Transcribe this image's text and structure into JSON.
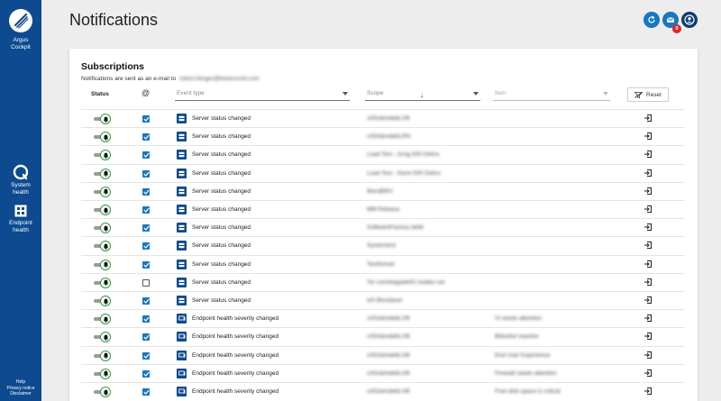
{
  "sidebar": {
    "brand": [
      "Argus",
      "Cockpit"
    ],
    "items": [
      {
        "label": [
          "System",
          "health"
        ],
        "icon": "system-health-icon"
      },
      {
        "label": [
          "Endpoint",
          "health"
        ],
        "icon": "endpoint-health-icon"
      }
    ],
    "footer": [
      "Help",
      "Privacy notice",
      "Disclaimer"
    ]
  },
  "header": {
    "title": "Notifications",
    "badge_count": "0"
  },
  "subscriptions": {
    "title": "Subscriptions",
    "subtitle": "Notifications are sent as an e-mail to",
    "email": "robert.klinger@betamundi.com",
    "col_status": "Status",
    "col_email": "@",
    "filter_event_type": "Event type",
    "filter_scope": "Scope",
    "filter_item": "Item",
    "reset_label": "Reset",
    "rows": [
      {
        "enabled": true,
        "email": true,
        "type": "server",
        "event": "Server status changed",
        "scope": "sXDsbmdebLXB",
        "item": ""
      },
      {
        "enabled": true,
        "email": true,
        "type": "server",
        "event": "Server status changed",
        "scope": "sXDsbmdebLRN",
        "item": ""
      },
      {
        "enabled": true,
        "email": true,
        "type": "server",
        "event": "Server status changed",
        "scope": "Load Test - Grog 500 Delivs",
        "item": ""
      },
      {
        "enabled": true,
        "email": true,
        "type": "server",
        "event": "Server status changed",
        "scope": "Load Test - Dorm 500 Delivs",
        "item": ""
      },
      {
        "enabled": true,
        "email": true,
        "type": "server",
        "event": "Server status changed",
        "scope": "MoroBRH",
        "item": ""
      },
      {
        "enabled": true,
        "email": true,
        "type": "server",
        "event": "Server status changed",
        "scope": "MM Release",
        "item": ""
      },
      {
        "enabled": true,
        "email": true,
        "type": "server",
        "event": "Server status changed",
        "scope": "SoftwareFactory debil",
        "item": ""
      },
      {
        "enabled": true,
        "email": true,
        "type": "server",
        "event": "Server status changed",
        "scope": "Systemtest",
        "item": ""
      },
      {
        "enabled": true,
        "email": true,
        "type": "server",
        "event": "Server status changed",
        "scope": "TestServer",
        "item": ""
      },
      {
        "enabled": true,
        "email": false,
        "type": "server",
        "event": "Server status changed",
        "scope": "Tor connhegadel01 kstdec-sel",
        "item": ""
      },
      {
        "enabled": true,
        "email": true,
        "type": "server",
        "event": "Server status changed",
        "scope": "wS Bloxdaxer",
        "item": ""
      },
      {
        "enabled": true,
        "email": true,
        "type": "endpoint",
        "event": "Endpoint health severity changed",
        "scope": "sXDsbmdebLXB",
        "item": "Vi needs attention"
      },
      {
        "enabled": true,
        "email": true,
        "type": "endpoint",
        "event": "Endpoint health severity changed",
        "scope": "sXDsbmdebLXB",
        "item": "Bitlocker inactive"
      },
      {
        "enabled": true,
        "email": true,
        "type": "endpoint",
        "event": "Endpoint health severity changed",
        "scope": "sXDsbmdebLXB",
        "item": "End User Experience"
      },
      {
        "enabled": true,
        "email": true,
        "type": "endpoint",
        "event": "Endpoint health severity changed",
        "scope": "sXDsbmdebLXB",
        "item": "Firewall needs attention"
      },
      {
        "enabled": true,
        "email": true,
        "type": "endpoint",
        "event": "Endpoint health severity changed",
        "scope": "sXDsbmdebLXB",
        "item": "Free disk space is critical"
      }
    ]
  }
}
